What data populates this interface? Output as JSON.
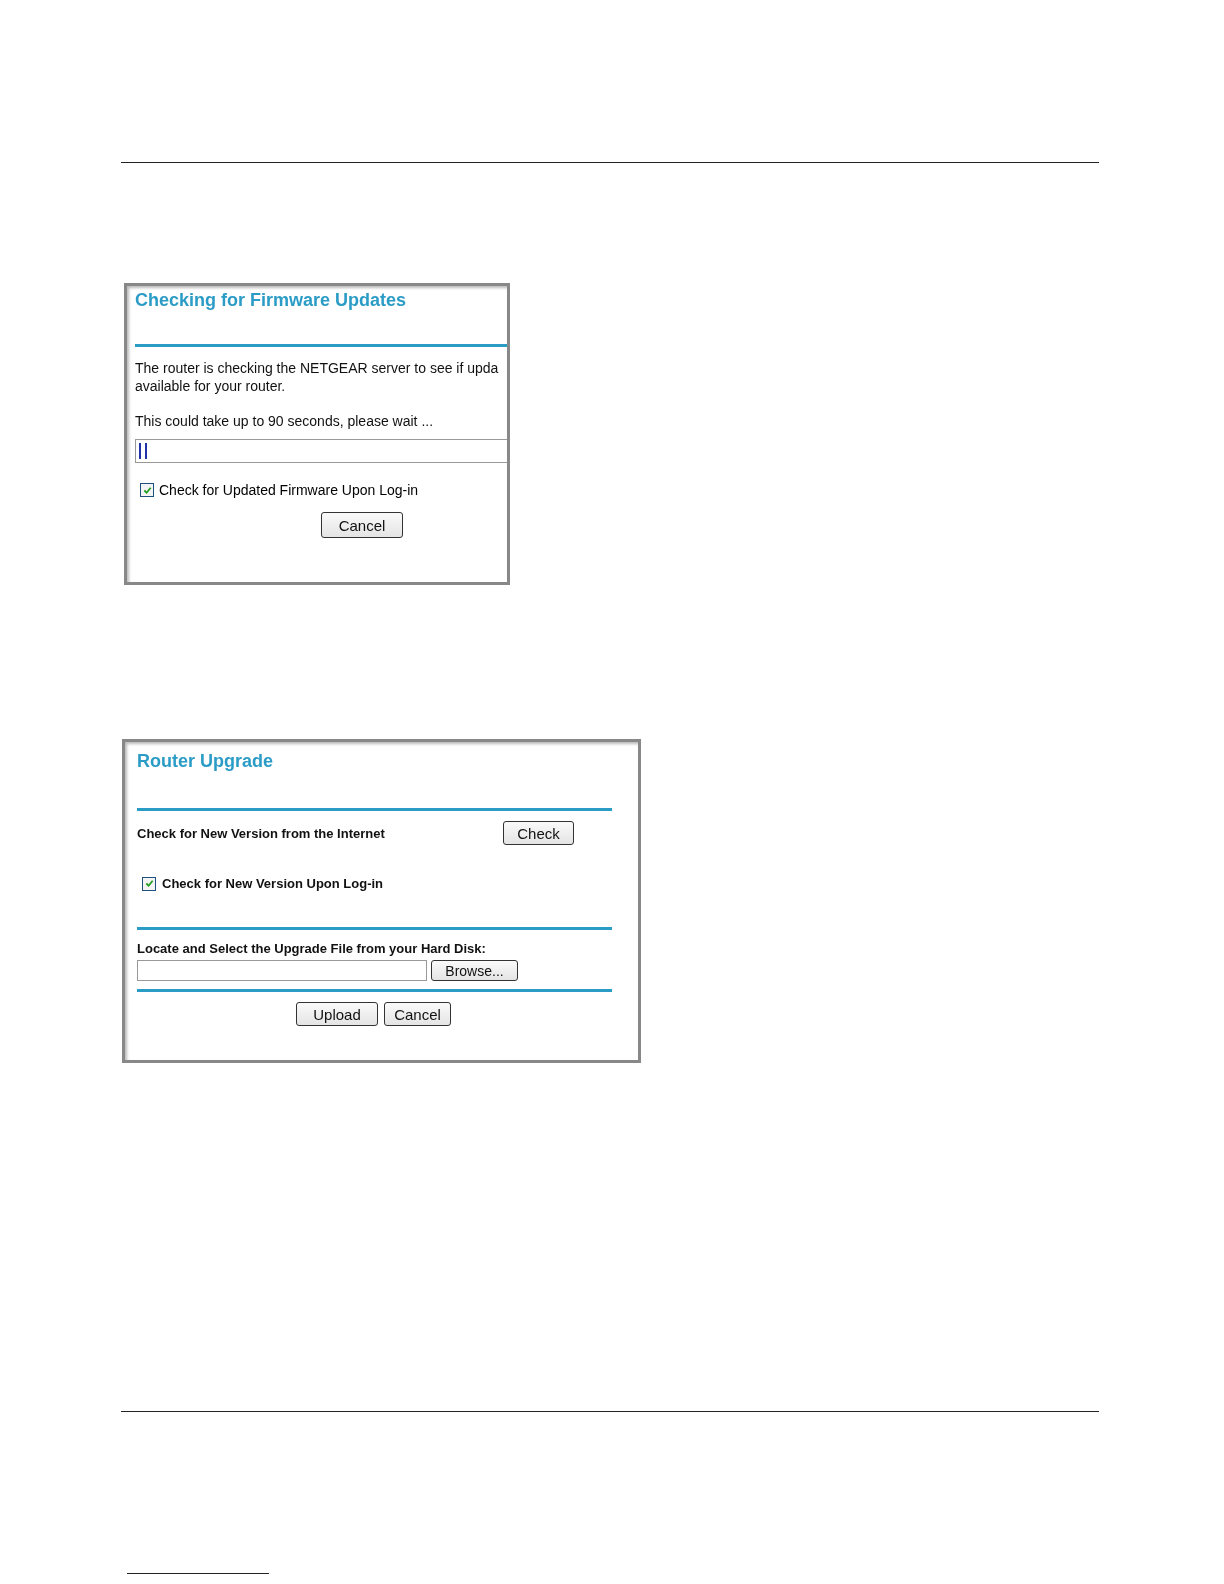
{
  "firmware_check": {
    "title": "Checking for Firmware Updates",
    "message_lines": [
      "The router is checking the NETGEAR server to see if upda",
      "available for your router."
    ],
    "wait_note": "This could take up to 90 seconds, please wait ...",
    "progress": {
      "level": 0.02
    },
    "checkbox": {
      "label": "Check for Updated Firmware Upon Log-in",
      "checked": true
    },
    "buttons": [
      "Cancel"
    ]
  },
  "router_upgrade": {
    "title": "Router Upgrade",
    "check_label": "Check for New Version from the Internet",
    "check_button": "Check",
    "login_checkbox": {
      "label": "Check for New Version Upon Log-in",
      "checked": true
    },
    "file_label": "Locate and Select the Upgrade File from your Hard Disk:",
    "browse_button": "Browse...",
    "buttons": [
      "Upload",
      "Cancel"
    ]
  }
}
